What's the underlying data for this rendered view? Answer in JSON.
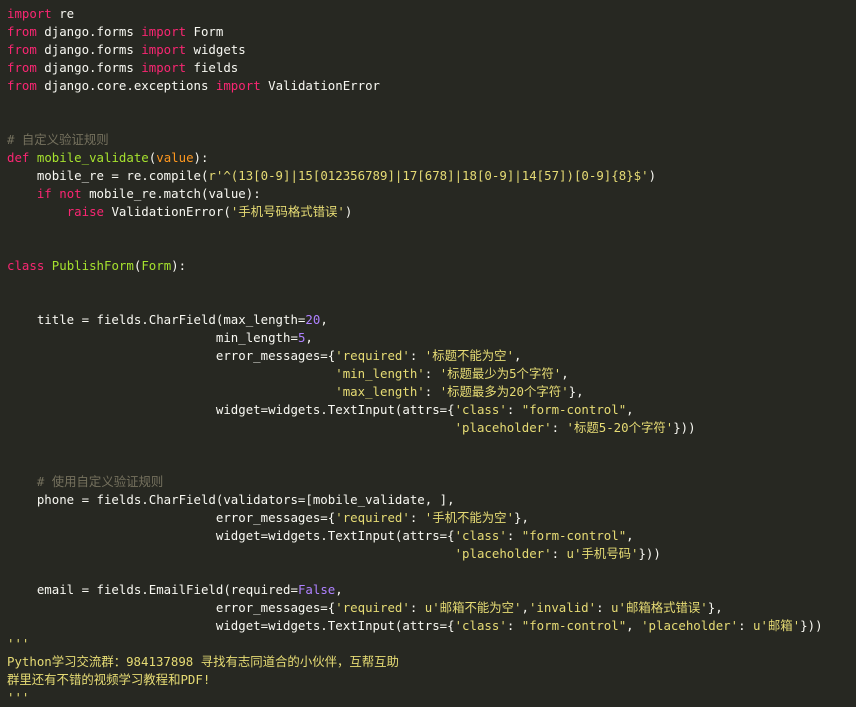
{
  "code": {
    "lines": [
      [
        {
          "t": "import",
          "c": "kw"
        },
        {
          "t": " re",
          "c": "txt"
        }
      ],
      [
        {
          "t": "from",
          "c": "kw"
        },
        {
          "t": " django.forms ",
          "c": "txt"
        },
        {
          "t": "import",
          "c": "kw"
        },
        {
          "t": " Form",
          "c": "txt"
        }
      ],
      [
        {
          "t": "from",
          "c": "kw"
        },
        {
          "t": " django.forms ",
          "c": "txt"
        },
        {
          "t": "import",
          "c": "kw"
        },
        {
          "t": " widgets",
          "c": "txt"
        }
      ],
      [
        {
          "t": "from",
          "c": "kw"
        },
        {
          "t": " django.forms ",
          "c": "txt"
        },
        {
          "t": "import",
          "c": "kw"
        },
        {
          "t": " fields",
          "c": "txt"
        }
      ],
      [
        {
          "t": "from",
          "c": "kw"
        },
        {
          "t": " django.core.exceptions ",
          "c": "txt"
        },
        {
          "t": "import",
          "c": "kw"
        },
        {
          "t": " ValidationError",
          "c": "txt"
        }
      ],
      [],
      [],
      [
        {
          "t": "# 自定义验证规则",
          "c": "cm"
        }
      ],
      [
        {
          "t": "def",
          "c": "kw"
        },
        {
          "t": " ",
          "c": "txt"
        },
        {
          "t": "mobile_validate",
          "c": "fn"
        },
        {
          "t": "(",
          "c": "txt"
        },
        {
          "t": "value",
          "c": "par"
        },
        {
          "t": "):",
          "c": "txt"
        }
      ],
      [
        {
          "t": "    mobile_re = re.compile(",
          "c": "txt"
        },
        {
          "t": "r'^(13[0-9]|15[012356789]|17[678]|18[0-9]|14[57])[0-9]{8}$'",
          "c": "str"
        },
        {
          "t": ")",
          "c": "txt"
        }
      ],
      [
        {
          "t": "    ",
          "c": "txt"
        },
        {
          "t": "if",
          "c": "kw"
        },
        {
          "t": " ",
          "c": "txt"
        },
        {
          "t": "not",
          "c": "kw"
        },
        {
          "t": " mobile_re.match(value):",
          "c": "txt"
        }
      ],
      [
        {
          "t": "        ",
          "c": "txt"
        },
        {
          "t": "raise",
          "c": "kw"
        },
        {
          "t": " ValidationError(",
          "c": "txt"
        },
        {
          "t": "'手机号码格式错误'",
          "c": "str"
        },
        {
          "t": ")",
          "c": "txt"
        }
      ],
      [],
      [],
      [
        {
          "t": "class",
          "c": "kw"
        },
        {
          "t": " ",
          "c": "txt"
        },
        {
          "t": "PublishForm",
          "c": "fn"
        },
        {
          "t": "(",
          "c": "txt"
        },
        {
          "t": "Form",
          "c": "fn"
        },
        {
          "t": "):",
          "c": "txt"
        }
      ],
      [],
      [],
      [
        {
          "t": "    title = fields.CharField(max_length=",
          "c": "txt"
        },
        {
          "t": "20",
          "c": "num"
        },
        {
          "t": ",",
          "c": "txt"
        }
      ],
      [
        {
          "t": "                            min_length=",
          "c": "txt"
        },
        {
          "t": "5",
          "c": "num"
        },
        {
          "t": ",",
          "c": "txt"
        }
      ],
      [
        {
          "t": "                            error_messages={",
          "c": "txt"
        },
        {
          "t": "'required'",
          "c": "str"
        },
        {
          "t": ": ",
          "c": "txt"
        },
        {
          "t": "'标题不能为空'",
          "c": "str"
        },
        {
          "t": ",",
          "c": "txt"
        }
      ],
      [
        {
          "t": "                                            ",
          "c": "txt"
        },
        {
          "t": "'min_length'",
          "c": "str"
        },
        {
          "t": ": ",
          "c": "txt"
        },
        {
          "t": "'标题最少为5个字符'",
          "c": "str"
        },
        {
          "t": ",",
          "c": "txt"
        }
      ],
      [
        {
          "t": "                                            ",
          "c": "txt"
        },
        {
          "t": "'max_length'",
          "c": "str"
        },
        {
          "t": ": ",
          "c": "txt"
        },
        {
          "t": "'标题最多为20个字符'",
          "c": "str"
        },
        {
          "t": "},",
          "c": "txt"
        }
      ],
      [
        {
          "t": "                            widget=widgets.TextInput(attrs={",
          "c": "txt"
        },
        {
          "t": "'class'",
          "c": "str"
        },
        {
          "t": ": ",
          "c": "txt"
        },
        {
          "t": "\"form-control\"",
          "c": "str"
        },
        {
          "t": ",",
          "c": "txt"
        }
      ],
      [
        {
          "t": "                                                            ",
          "c": "txt"
        },
        {
          "t": "'placeholder'",
          "c": "str"
        },
        {
          "t": ": ",
          "c": "txt"
        },
        {
          "t": "'标题5-20个字符'",
          "c": "str"
        },
        {
          "t": "}))",
          "c": "txt"
        }
      ],
      [],
      [],
      [
        {
          "t": "    # 使用自定义验证规则",
          "c": "cm"
        }
      ],
      [
        {
          "t": "    phone = fields.CharField(validators=[mobile_validate, ],",
          "c": "txt"
        }
      ],
      [
        {
          "t": "                            error_messages={",
          "c": "txt"
        },
        {
          "t": "'required'",
          "c": "str"
        },
        {
          "t": ": ",
          "c": "txt"
        },
        {
          "t": "'手机不能为空'",
          "c": "str"
        },
        {
          "t": "},",
          "c": "txt"
        }
      ],
      [
        {
          "t": "                            widget=widgets.TextInput(attrs={",
          "c": "txt"
        },
        {
          "t": "'class'",
          "c": "str"
        },
        {
          "t": ": ",
          "c": "txt"
        },
        {
          "t": "\"form-control\"",
          "c": "str"
        },
        {
          "t": ",",
          "c": "txt"
        }
      ],
      [
        {
          "t": "                                                            ",
          "c": "txt"
        },
        {
          "t": "'placeholder'",
          "c": "str"
        },
        {
          "t": ": ",
          "c": "txt"
        },
        {
          "t": "u'手机号码'",
          "c": "str"
        },
        {
          "t": "}))",
          "c": "txt"
        }
      ],
      [],
      [
        {
          "t": "    email = fields.EmailField(required=",
          "c": "txt"
        },
        {
          "t": "False",
          "c": "num"
        },
        {
          "t": ",",
          "c": "txt"
        }
      ],
      [
        {
          "t": "                            error_messages={",
          "c": "txt"
        },
        {
          "t": "'required'",
          "c": "str"
        },
        {
          "t": ": ",
          "c": "txt"
        },
        {
          "t": "u'邮箱不能为空'",
          "c": "str"
        },
        {
          "t": ",",
          "c": "txt"
        },
        {
          "t": "'invalid'",
          "c": "str"
        },
        {
          "t": ": ",
          "c": "txt"
        },
        {
          "t": "u'邮箱格式错误'",
          "c": "str"
        },
        {
          "t": "},",
          "c": "txt"
        }
      ],
      [
        {
          "t": "                            widget=widgets.TextInput(attrs={",
          "c": "txt"
        },
        {
          "t": "'class'",
          "c": "str"
        },
        {
          "t": ": ",
          "c": "txt"
        },
        {
          "t": "\"form-control\"",
          "c": "str"
        },
        {
          "t": ", ",
          "c": "txt"
        },
        {
          "t": "'placeholder'",
          "c": "str"
        },
        {
          "t": ": ",
          "c": "txt"
        },
        {
          "t": "u'邮箱'",
          "c": "str"
        },
        {
          "t": "}))",
          "c": "txt"
        }
      ],
      [
        {
          "t": "'''",
          "c": "str"
        }
      ],
      [
        {
          "t": "Python学习交流群：984137898 寻找有志同道合的小伙伴，互帮互助",
          "c": "str"
        }
      ],
      [
        {
          "t": "群里还有不错的视频学习教程和PDF!",
          "c": "str"
        }
      ],
      [
        {
          "t": "'''",
          "c": "str"
        }
      ]
    ]
  },
  "colors": {
    "background": "#272822",
    "keyword": "#f92672",
    "function": "#a6e22e",
    "string": "#e6db74",
    "comment": "#75715e",
    "number": "#ae81ff",
    "text": "#f8f8f2",
    "parameter": "#fd971f"
  }
}
